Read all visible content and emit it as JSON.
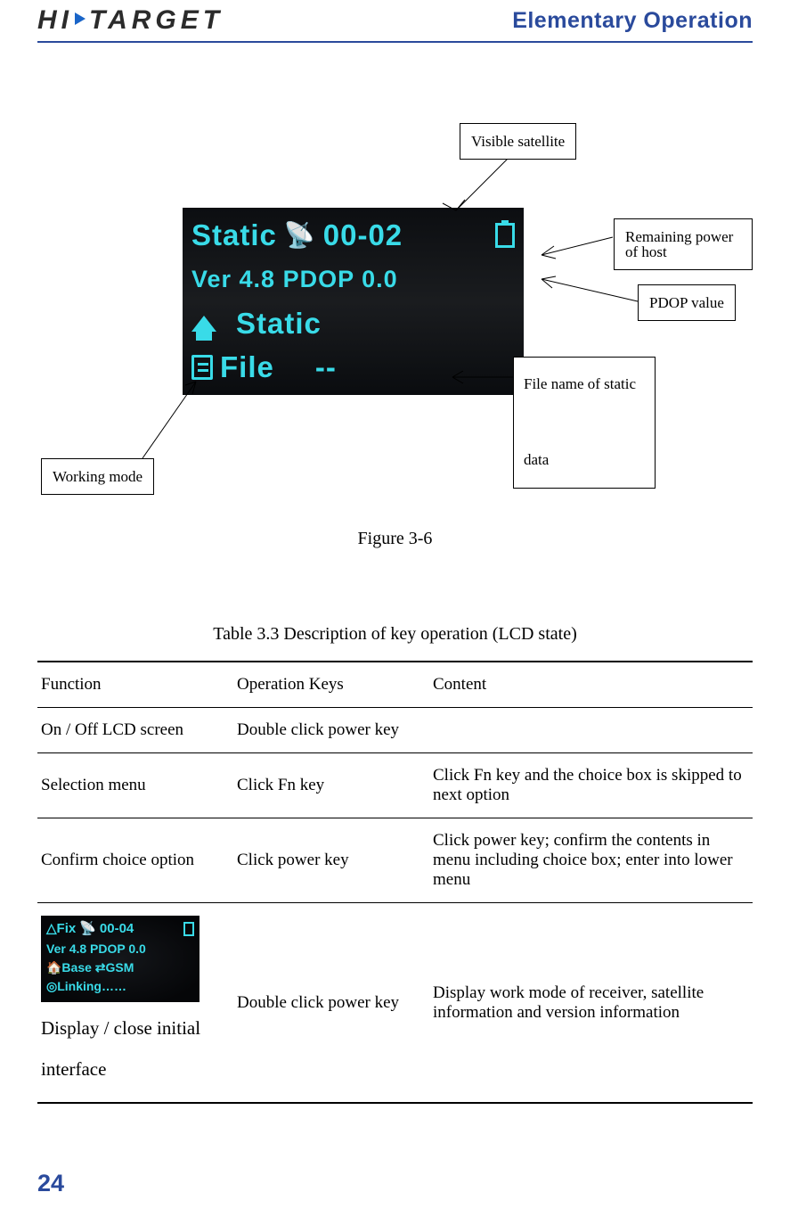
{
  "header": {
    "brand_left": "HI",
    "brand_right": "TARGET",
    "section": "Elementary Operation"
  },
  "diagram": {
    "callouts": {
      "visible_sat": "Visible satellite",
      "remaining_power": "Remaining power of host",
      "pdop": "PDOP value",
      "file_name": "File name of static\n\ndata",
      "working_mode": "Working mode"
    },
    "lcd": {
      "row1_a": "Static",
      "row1_b": "00-02",
      "row2": "Ver  4.8  PDOP 0.0",
      "row3": "Static",
      "row4_a": "File",
      "row4_b": "--"
    },
    "caption": "Figure 3-6"
  },
  "table": {
    "caption": "Table 3.3 Description of key operation (LCD state)",
    "headers": {
      "c1": "Function",
      "c2": "Operation Keys",
      "c3": "Content"
    },
    "rows": [
      {
        "c1": "On / Off LCD screen",
        "c2": "Double click power key",
        "c3": ""
      },
      {
        "c1": "Selection menu",
        "c2": "Click Fn key",
        "c3": "Click Fn key and the choice box is skipped to next option"
      },
      {
        "c1": "Confirm choice option",
        "c2": "Click power key",
        "c3": "Click power key; confirm the contents in menu including choice box; enter into lower menu"
      },
      {
        "c1_label": "Display / close initial interface",
        "mini": {
          "l1a": "△Fix",
          "l1b": "00-04",
          "l2": "Ver 4.8 PDOP 0.0",
          "l3": "🏠Base  ⇄GSM",
          "l4": "◎Linking……"
        },
        "c2": "Double click power key",
        "c3": "Display work mode of receiver, satellite information and version information"
      }
    ]
  },
  "page": "24"
}
